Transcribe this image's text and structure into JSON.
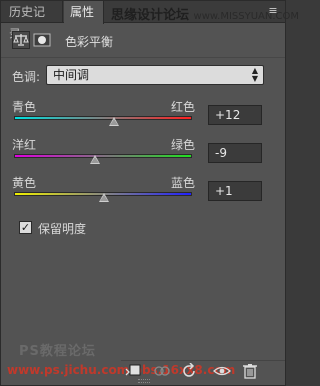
{
  "tabs": [
    {
      "label": "历史记录"
    },
    {
      "label": "属性"
    }
  ],
  "watermark_top": {
    "cn": "思缘设计论坛",
    "en": "www.MISSYUAN.COM"
  },
  "header": {
    "title": "色彩平衡"
  },
  "tone": {
    "label": "色调:",
    "value": "中间调"
  },
  "sliders": [
    {
      "left": "青色",
      "right": "红色",
      "value": "+12",
      "level": 0.56,
      "gradient": [
        "#00e0e0",
        "#ff2020"
      ]
    },
    {
      "left": "洋红",
      "right": "绿色",
      "value": "-9",
      "level": 0.455,
      "gradient": [
        "#e000e0",
        "#20e020"
      ]
    },
    {
      "left": "黄色",
      "right": "蓝色",
      "value": "+1",
      "level": 0.505,
      "gradient": [
        "#f0f000",
        "#2020ff"
      ]
    }
  ],
  "preserve": {
    "label": "保留明度",
    "checked": true
  },
  "watermarks_bottom": {
    "line1": "PS教程论坛",
    "line2": "www.ps.jichu.com bbs.16xx8.com"
  },
  "colors": {
    "panel": "#535353",
    "tabbar": "#3b3b3b",
    "accent_watermark": "#c0392b"
  }
}
